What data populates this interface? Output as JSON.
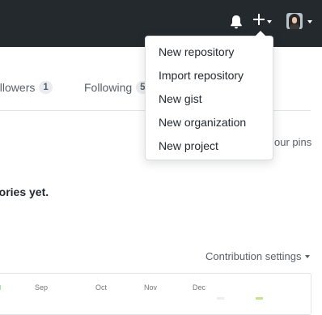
{
  "header": {
    "icons": [
      "bell-icon",
      "plus-icon",
      "avatar"
    ]
  },
  "tabs": [
    {
      "label": "ollowers",
      "count": "1"
    },
    {
      "label": "Following",
      "count": "5"
    }
  ],
  "pinned": {
    "link": "our pins"
  },
  "repositories": {
    "empty_message": "tories yet."
  },
  "contributions": {
    "settings_label": "Contribution settings",
    "months": [
      "Sep",
      "Oct",
      "Nov",
      "Dec"
    ]
  },
  "new_menu": {
    "items": [
      {
        "label": "New repository"
      },
      {
        "label": "Import repository"
      },
      {
        "label": "New gist"
      },
      {
        "label": "New organization"
      },
      {
        "label": "New project"
      }
    ]
  },
  "colors": {
    "header_bg": "#24292e",
    "text": "#24292e",
    "muted": "#586069",
    "border": "#e1e4e8"
  }
}
